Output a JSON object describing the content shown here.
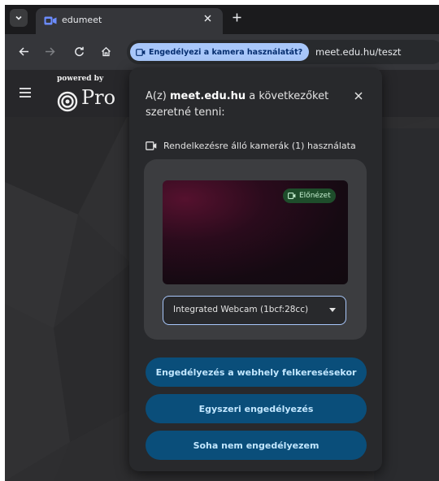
{
  "browser": {
    "tab": {
      "title": "edumeet"
    },
    "toolbar": {
      "permission_chip": "Engedélyezi a kamera használatát?",
      "url": "meet.edu.hu/teszt"
    }
  },
  "app": {
    "powered_by": "powered by",
    "logo_text": "Pro"
  },
  "popup": {
    "title_prefix": "A(z) ",
    "title_site": "meet.edu.hu",
    "title_suffix": " a következőket szeretné tenni:",
    "permission_label": "Rendelkezésre álló kamerák (1) használata",
    "preview_badge": "Előnézet",
    "camera_select": {
      "selected": "Integrated Webcam (1bcf:28cc)"
    },
    "buttons": {
      "allow_while_visiting": "Engedélyezés a webhely felkeresésekor",
      "allow_once": "Egyszeri engedélyezés",
      "never_allow": "Soha nem engedélyezem"
    }
  },
  "colors": {
    "accent_button": "#0a4e7a",
    "permission_chip": "#a8c7fa",
    "preview_badge": "#1e4d2b"
  }
}
